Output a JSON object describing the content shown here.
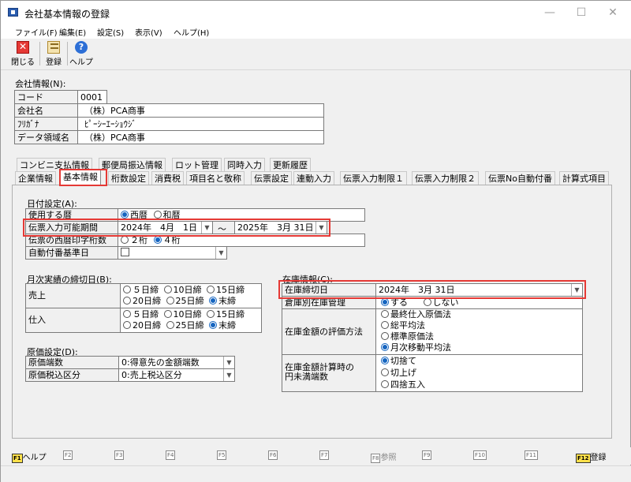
{
  "window": {
    "title": "会社基本情報の登録",
    "minimize": "—",
    "maximize": "☐",
    "close": "✕"
  },
  "menu": [
    "ファイル(F)",
    "編集(E)",
    "設定(S)",
    "表示(V)",
    "ヘルプ(H)"
  ],
  "toolbar": {
    "close": "閉じる",
    "register": "登録",
    "help": "ヘルプ"
  },
  "company": {
    "section_label": "会社情報(N):",
    "rows": [
      {
        "label": "コード",
        "value": "0001"
      },
      {
        "label": "会社名",
        "value": "（株）PCA商事"
      },
      {
        "label": "ﾌﾘｶﾞﾅ",
        "value": "ﾋﾟｰｼｰｴｰｼｮｳｼﾞ"
      },
      {
        "label": "データ領域名",
        "value": "（株）PCA商事"
      }
    ]
  },
  "tabs_row1": [
    "コンビニ支払情報",
    "郵便局振込情報",
    "ロット管理",
    "同時入力",
    "更新履歴"
  ],
  "tabs_row2": [
    "企業情報",
    "基本情報",
    "桁数設定",
    "消費税",
    "項目名と敬称",
    "伝票設定",
    "連動入力",
    "伝票入力制限１",
    "伝票入力制限２",
    "伝票No自動付番",
    "計算式項目"
  ],
  "date": {
    "section_label": "日付設定(A):",
    "calendar_label": "使用する暦",
    "calendar_opts": [
      "西暦",
      "和暦"
    ],
    "period_label": "伝票入力可能期間",
    "period_from": "2024年　4月　1日",
    "period_sep": "～",
    "period_to": "2025年　3月 31日",
    "print_label": "伝票の西暦印字桁数",
    "print_opts": [
      "２桁",
      "４桁"
    ],
    "auto_label": "自動付番基準日"
  },
  "closing": {
    "section_label": "月次実績の締切日(B):",
    "sales_label": "売上",
    "purchase_label": "仕入",
    "opts_row1": [
      "５日締",
      "10日締",
      "15日締"
    ],
    "opts_row2": [
      "20日締",
      "25日締",
      "末締"
    ]
  },
  "cost": {
    "section_label": "原価設定(D):",
    "fraction_label": "原価端数",
    "fraction_value": "0:得意先の金額端数",
    "tax_label": "原価税込区分",
    "tax_value": "0:売上税込区分"
  },
  "stock": {
    "section_label": "在庫情報(C):",
    "closing_label": "在庫締切日",
    "closing_value": "2024年　3月 31日",
    "warehouse_label": "倉庫別在庫管理",
    "warehouse_opts": [
      "する",
      "しない"
    ],
    "valuation_label": "在庫金額の評価方法",
    "valuation_opts": [
      "最終仕入原価法",
      "総平均法",
      "標準原価法",
      "月次移動平均法"
    ],
    "rounding_label_1": "在庫金額計算時の",
    "rounding_label_2": "円未満端数",
    "rounding_opts": [
      "切捨て",
      "切上げ",
      "四捨五入"
    ]
  },
  "fkeys": [
    {
      "key": "F1",
      "label": "ヘルプ"
    },
    {
      "key": "F2",
      "label": ""
    },
    {
      "key": "F3",
      "label": ""
    },
    {
      "key": "F4",
      "label": ""
    },
    {
      "key": "F5",
      "label": ""
    },
    {
      "key": "F6",
      "label": ""
    },
    {
      "key": "F7",
      "label": ""
    },
    {
      "key": "F8",
      "label": "参照"
    },
    {
      "key": "F9",
      "label": ""
    },
    {
      "key": "F10",
      "label": ""
    },
    {
      "key": "F11",
      "label": ""
    },
    {
      "key": "F12",
      "label": "登録"
    }
  ]
}
